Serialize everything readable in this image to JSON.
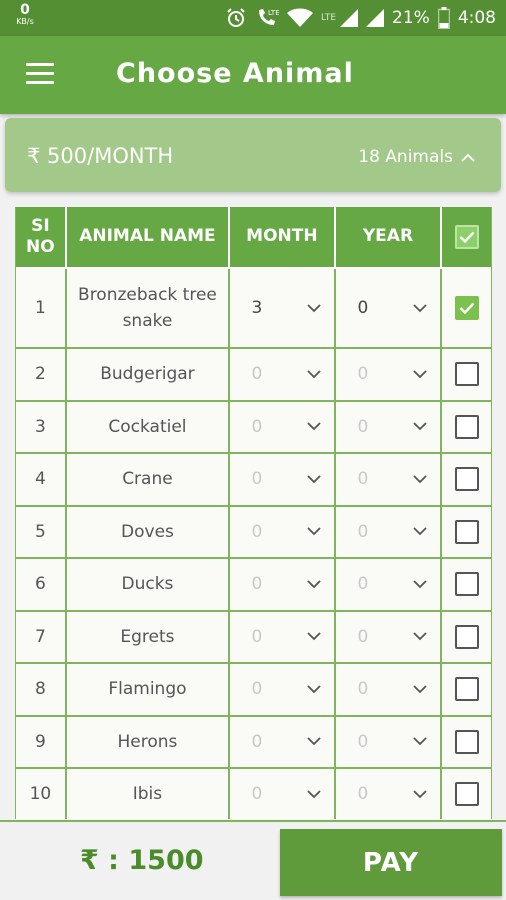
{
  "status_bar": {
    "speed_value": "0",
    "speed_unit": "KB/s",
    "network": "LTE",
    "battery": "21%",
    "time": "4:08"
  },
  "app_bar": {
    "title": "Choose Animal",
    "menu_icon": "hamburger-menu-icon"
  },
  "plan": {
    "price": "₹ 500/MONTH",
    "count": "18 Animals",
    "toggle_icon": "chevron-up-icon"
  },
  "table": {
    "headers": {
      "si_no_line1": "SI",
      "si_no_line2": "NO",
      "animal_name": "ANIMAL NAME",
      "month": "MONTH",
      "year": "YEAR"
    },
    "select_all_checked": true,
    "rows": [
      {
        "no": "1",
        "name": "Bronzeback tree snake",
        "month": "3",
        "year": "0",
        "checked": true
      },
      {
        "no": "2",
        "name": "Budgerigar",
        "month": "0",
        "year": "0",
        "checked": false
      },
      {
        "no": "3",
        "name": "Cockatiel",
        "month": "0",
        "year": "0",
        "checked": false
      },
      {
        "no": "4",
        "name": "Crane",
        "month": "0",
        "year": "0",
        "checked": false
      },
      {
        "no": "5",
        "name": "Doves",
        "month": "0",
        "year": "0",
        "checked": false
      },
      {
        "no": "6",
        "name": "Ducks",
        "month": "0",
        "year": "0",
        "checked": false
      },
      {
        "no": "7",
        "name": "Egrets",
        "month": "0",
        "year": "0",
        "checked": false
      },
      {
        "no": "8",
        "name": "Flamingo",
        "month": "0",
        "year": "0",
        "checked": false
      },
      {
        "no": "9",
        "name": "Herons",
        "month": "0",
        "year": "0",
        "checked": false
      },
      {
        "no": "10",
        "name": "Ibis",
        "month": "0",
        "year": "0",
        "checked": false
      }
    ]
  },
  "footer": {
    "total": "₹ : 1500",
    "pay_label": "PAY"
  },
  "colors": {
    "primary": "#66a944",
    "status_bar": "#548f34",
    "plan_card": "#a3c98a",
    "check_green": "#7cc04e",
    "total_text": "#4a8c2a"
  }
}
